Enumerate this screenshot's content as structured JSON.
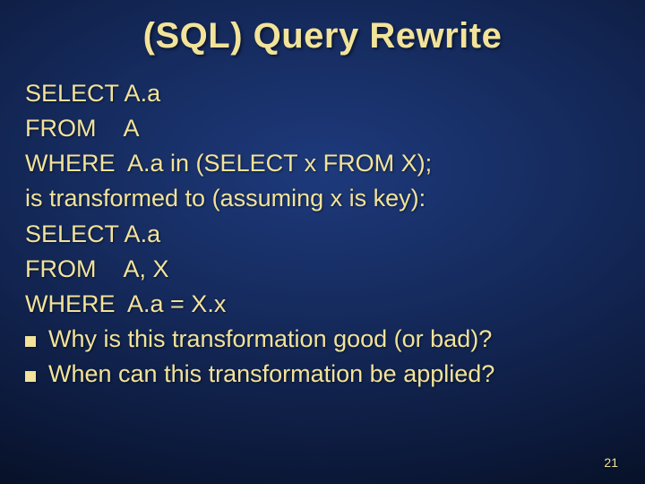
{
  "title": "(SQL) Query Rewrite",
  "lines": {
    "l0": "SELECT A.a",
    "l1": "FROM    A",
    "l2": "WHERE  A.a in (SELECT x FROM X);",
    "l3": "is transformed to (assuming x is key):",
    "l4": "SELECT A.a",
    "l5": "FROM    A, X",
    "l6": "WHERE  A.a = X.x"
  },
  "bullets": {
    "b0": "Why is this transformation good (or bad)?",
    "b1": "When can this transformation be applied?"
  },
  "slide_number": "21"
}
